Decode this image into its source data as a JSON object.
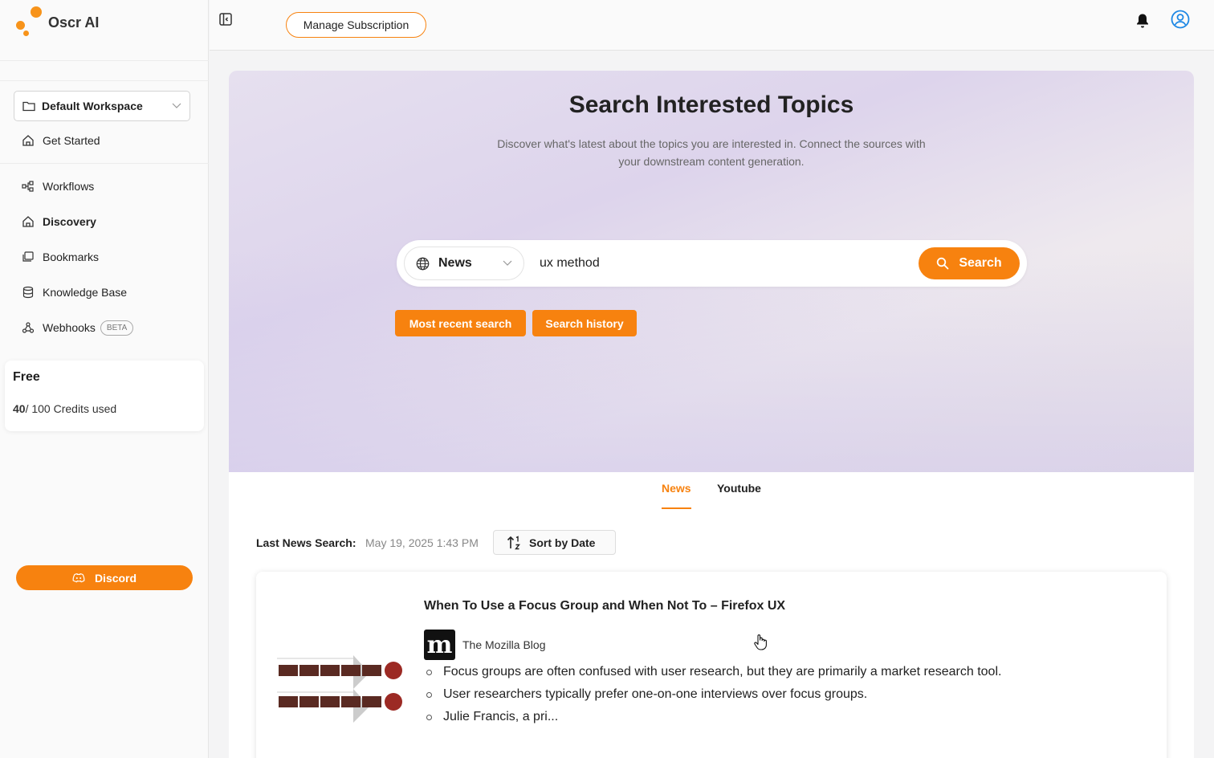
{
  "app": {
    "name": "Oscr AI",
    "brand_color": "#f7820f"
  },
  "sidebar": {
    "workspace": "Default Workspace",
    "items": [
      {
        "label": "Get Started",
        "icon": "home-icon"
      },
      {
        "label": "Workflows",
        "icon": "workflow-icon"
      },
      {
        "label": "Discovery",
        "icon": "home-icon",
        "active": true
      },
      {
        "label": "Bookmarks",
        "icon": "bookmark-icon"
      },
      {
        "label": "Knowledge Base",
        "icon": "database-icon"
      },
      {
        "label": "Webhooks",
        "icon": "webhook-icon",
        "badge": "BETA"
      }
    ],
    "plan": {
      "name": "Free",
      "credits_used": "40",
      "credits_text": "/ 100 Credits used"
    },
    "discord_label": "Discord"
  },
  "topbar": {
    "manage_label": "Manage Subscription"
  },
  "hero": {
    "title": "Search Interested Topics",
    "subtitle": "Discover what's latest about the topics you are interested in. Connect the sources with your downstream content generation."
  },
  "search": {
    "source": "News",
    "query": "ux method",
    "button_label": "Search",
    "chips": [
      "Most recent search",
      "Search history"
    ]
  },
  "tabs": [
    {
      "label": "News",
      "active": true
    },
    {
      "label": "Youtube",
      "active": false
    }
  ],
  "results": {
    "last_search_label": "Last News Search:",
    "last_search_date": "May 19, 2025 1:43 PM",
    "sort_label": "Sort by Date",
    "items": [
      {
        "title": "When To Use a Focus Group and When Not To – Firefox UX",
        "source": "The Mozilla Blog",
        "source_logo": "m",
        "bullets": [
          "Focus groups are often confused with user research, but they are primarily a market research tool.",
          "User researchers typically prefer one-on-one interviews over focus groups.",
          "Julie Francis, a pri..."
        ]
      }
    ]
  }
}
